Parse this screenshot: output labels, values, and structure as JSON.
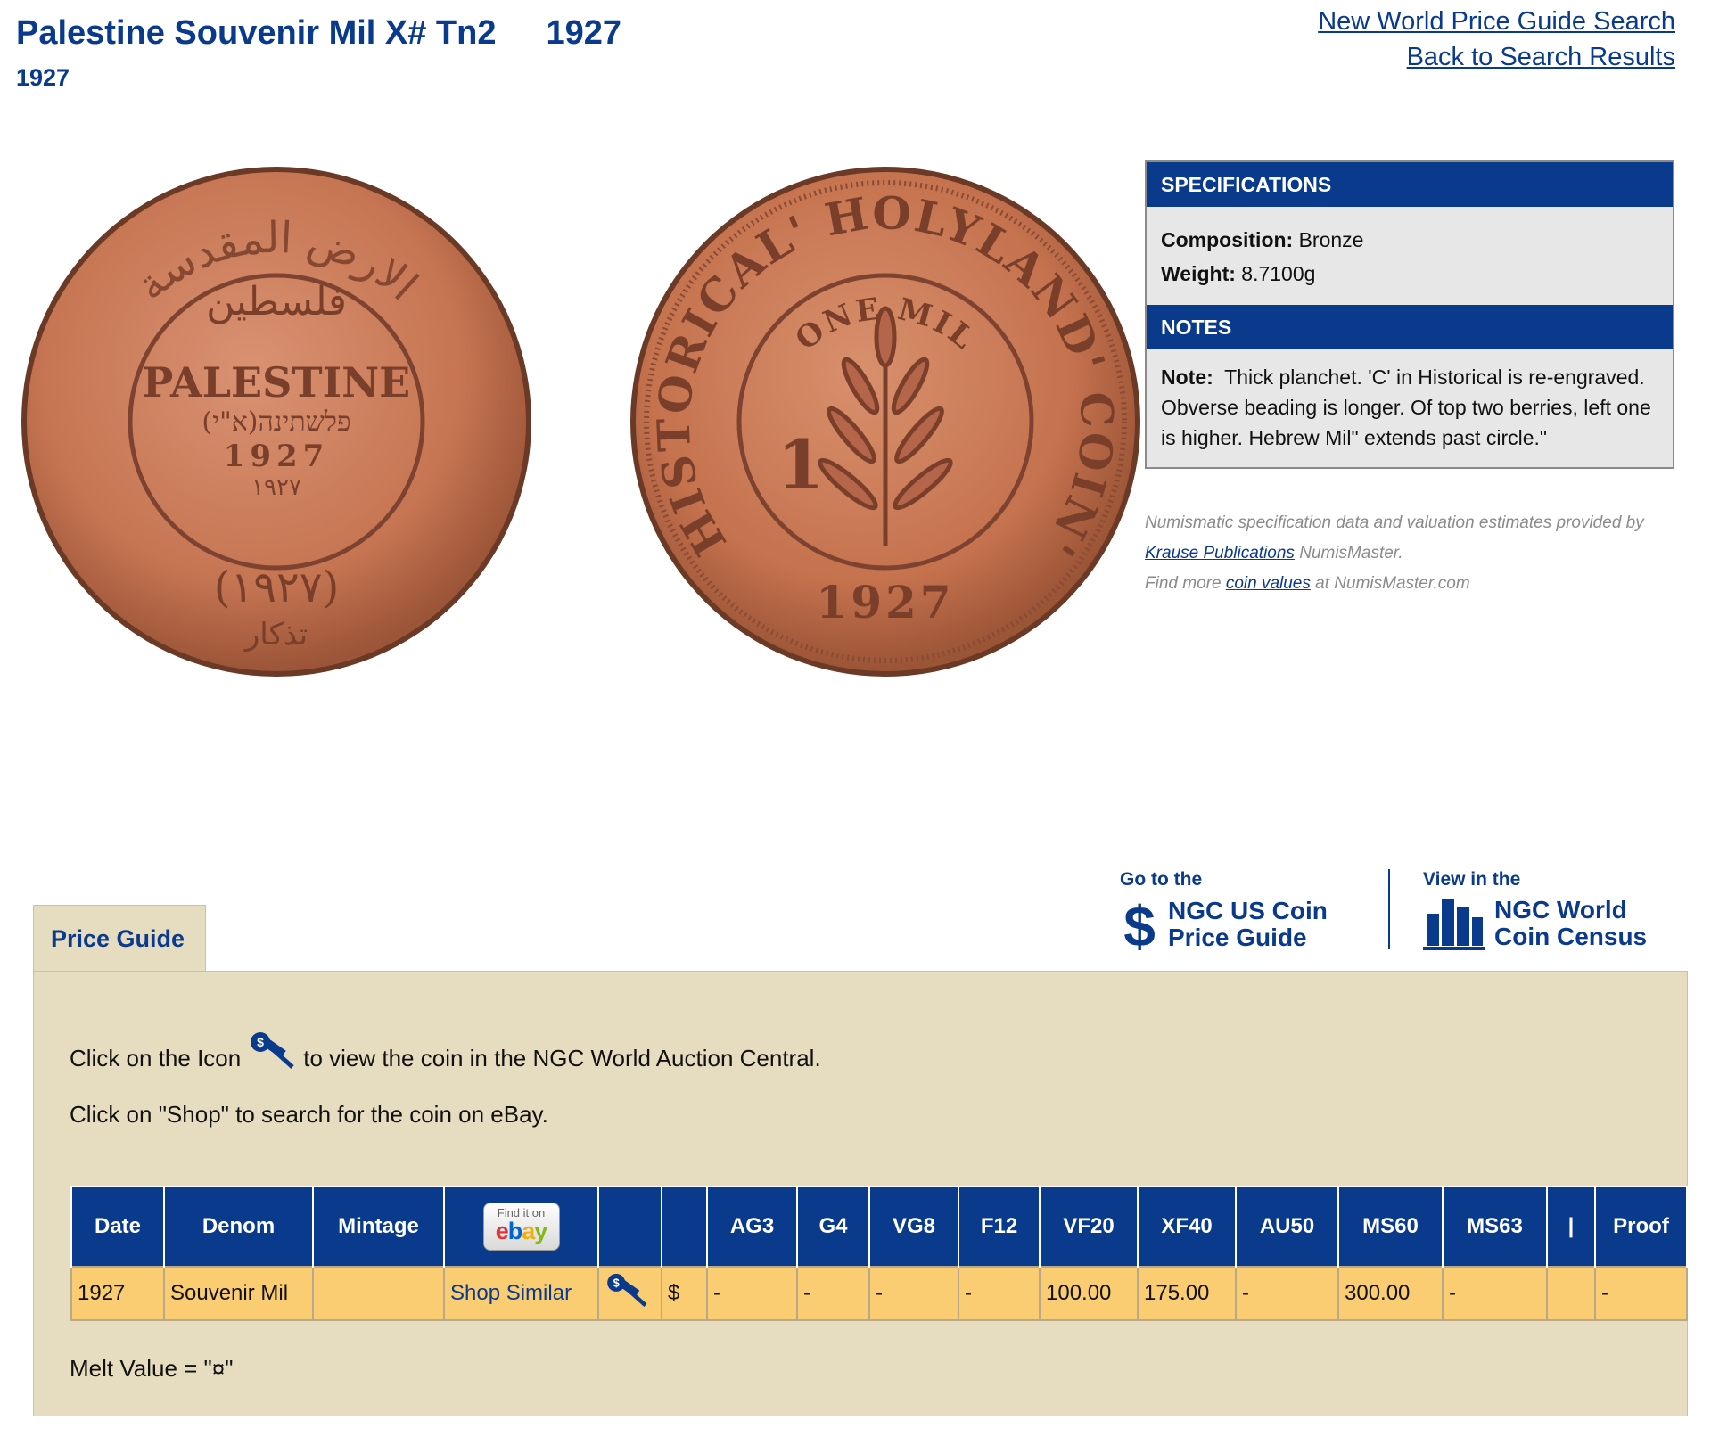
{
  "header": {
    "title": "Palestine Souvenir Mil X# Tn2",
    "title_year": "1927",
    "subtitle": "1927"
  },
  "nav_links": {
    "search": "New World Price Guide Search",
    "back": "Back to Search Results"
  },
  "coin_obverse": {
    "text_main": "PALESTINE",
    "text_hebrew": "(פלשתינה(א\"י",
    "text_arabic_center": "فلسطين",
    "year": "1927",
    "year_arabic": "١٩٢٧",
    "arabic_top": "الارض المقدسة",
    "arabic_bottom": "(١٩٢٧)",
    "arabic_hajib": "تذكار"
  },
  "coin_reverse": {
    "legend": "HISTORICAL' HOLYLAND' COIN'",
    "center_text": "ONE MIL",
    "denomination": "1",
    "year": "1927"
  },
  "specifications": {
    "heading": "SPECIFICATIONS",
    "composition_label": "Composition:",
    "composition": "Bronze",
    "weight_label": "Weight:",
    "weight": "8.7100g"
  },
  "notes": {
    "heading": "NOTES",
    "label": "Note:",
    "text": "Thick planchet. 'C' in Historical is re-engraved. Obverse beading is longer. Of top two berries, left one is higher. Hebrew Mil\" extends past circle.\""
  },
  "credit": {
    "line1": "Numismatic specification data and valuation estimates provided by",
    "krause": "Krause Publications",
    "numismaster": "NumisMaster.",
    "find_more": "Find more",
    "coin_values": "coin values",
    "at": "at NumisMaster.com"
  },
  "promo_us": {
    "small": "Go to the",
    "line1": "NGC US Coin",
    "line2": "Price Guide"
  },
  "promo_census": {
    "small": "View in the",
    "line1": "NGC World",
    "line2": "Coin Census"
  },
  "price_guide": {
    "tab_label": "Price Guide",
    "instruction1_before": "Click on the Icon",
    "instruction1_after": "to view the coin in the NGC World Auction Central.",
    "instruction2": "Click on \"Shop\" to search for the coin on eBay.",
    "ebay_small": "Find it on",
    "ebay_big": "ebay",
    "headers": [
      "Date",
      "Denom",
      "Mintage",
      "",
      "",
      "",
      "AG3",
      "G4",
      "VG8",
      "F12",
      "VF20",
      "XF40",
      "AU50",
      "MS60",
      "MS63",
      "|",
      "Proof"
    ],
    "row": {
      "date": "1927",
      "denom": "Souvenir Mil",
      "mintage": "",
      "shop": "Shop Similar",
      "currency": "$",
      "ag3": "-",
      "g4": "-",
      "vg8": "-",
      "f12": "-",
      "vf20": "100.00",
      "xf40": "175.00",
      "au50": "-",
      "ms60": "300.00",
      "ms63": "-",
      "sep": "",
      "proof": "-"
    },
    "melt_value": "Melt Value = \"¤\""
  },
  "colors": {
    "brand_blue": "#0a3a8c",
    "panel_tan": "#e6dcc0",
    "row_yellow": "#fbcd72",
    "coin_copper": "#c87a55"
  }
}
